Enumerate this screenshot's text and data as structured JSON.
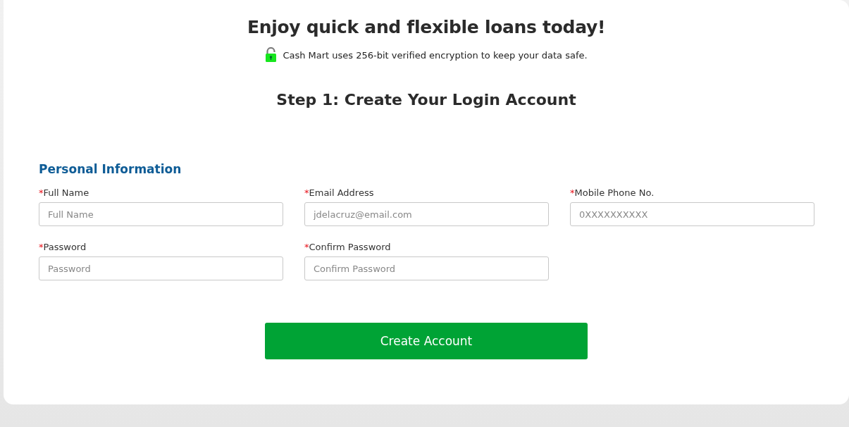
{
  "heading": "Enjoy quick and flexible loans today!",
  "security_note": "Cash Mart uses 256-bit verified encryption to keep your data safe.",
  "step_title": "Step 1: Create Your Login Account",
  "section_title": "Personal Information",
  "required_mark": "*",
  "fields": [
    {
      "label": "Full Name",
      "placeholder": "Full Name",
      "required": true
    },
    {
      "label": "Email Address",
      "placeholder": "jdelacruz@email.com",
      "required": true
    },
    {
      "label": "Mobile Phone No.",
      "placeholder": "0XXXXXXXXXX",
      "required": true
    },
    {
      "label": "Password",
      "placeholder": "Password",
      "required": true
    },
    {
      "label": "Confirm Password",
      "placeholder": "Confirm Password",
      "required": true
    }
  ],
  "submit_button": "Create Account"
}
